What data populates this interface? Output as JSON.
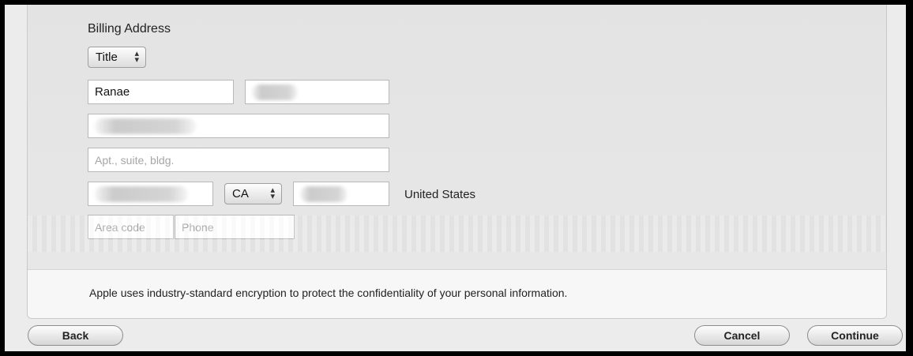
{
  "billing": {
    "title": "Billing Address",
    "title_select": "Title",
    "first_name": "Ranae",
    "apt_placeholder": "Apt., suite, bldg.",
    "state": "CA",
    "country": "United States",
    "area_code_placeholder": "Area code",
    "phone_placeholder": "Phone"
  },
  "notice": "Apple uses industry-standard encryption to protect the confidentiality of your personal information.",
  "buttons": {
    "back": "Back",
    "cancel": "Cancel",
    "continue": "Continue"
  },
  "icons": {
    "select_arrows": "up-down-chevrons-icon"
  }
}
